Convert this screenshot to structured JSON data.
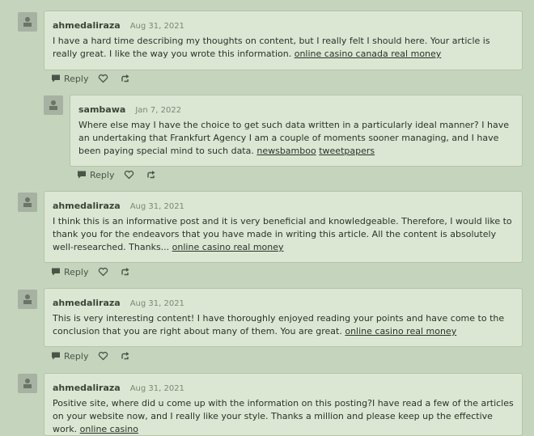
{
  "actions": {
    "reply_label": "Reply"
  },
  "comments": [
    {
      "author": "ahmedaliraza",
      "date": "Aug 31, 2021",
      "text": "I have a hard time describing my thoughts on content, but I really felt I should here. Your article is really great. I like the way you wrote this information.",
      "links": [
        "online casino canada real money"
      ]
    },
    {
      "author": "sambawa",
      "date": "Jan 7, 2022",
      "text": "Where else may I have the choice to get such data written in a particularly ideal manner? I have an undertaking that Frankfurt Agency I am a couple of moments sooner managing, and I have been paying special mind to such data.",
      "links": [
        "newsbamboo",
        "tweetpapers"
      ]
    },
    {
      "author": "ahmedaliraza",
      "date": "Aug 31, 2021",
      "text": "I think this is an informative post and it is very beneficial and knowledgeable. Therefore, I would like to thank you for the endeavors that you have made in writing this article. All the content is absolutely well-researched. Thanks...",
      "links": [
        "online casino real money"
      ]
    },
    {
      "author": "ahmedaliraza",
      "date": "Aug 31, 2021",
      "text": "This is very interesting content! I have thoroughly enjoyed reading your points and have come to the conclusion that you are right about many of them. You are great.",
      "links": [
        "online casino real money"
      ]
    },
    {
      "author": "ahmedaliraza",
      "date": "Aug 31, 2021",
      "text": "Positive site, where did u come up with the information on this posting?I have read a few of the articles on your website now, and I really like your style. Thanks a million and please keep up the effective work.",
      "links": [
        "online casino"
      ]
    }
  ]
}
